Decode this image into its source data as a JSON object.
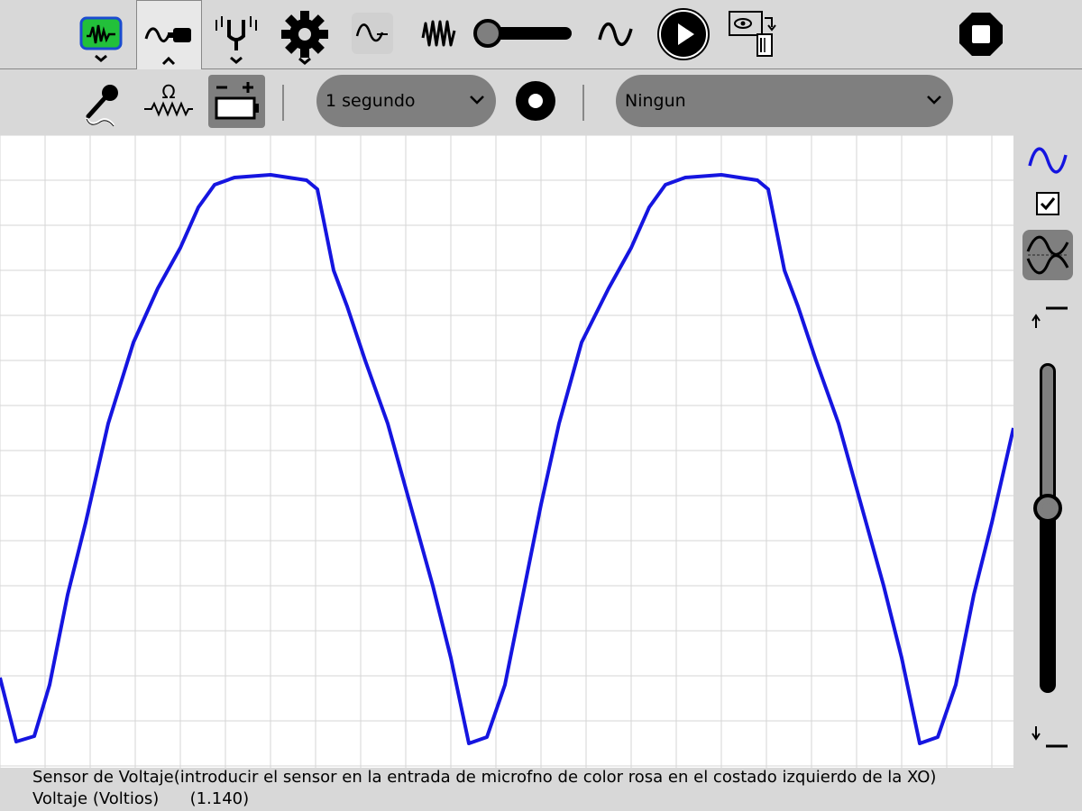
{
  "toolbar": {
    "items": [
      {
        "name": "activity-icon"
      },
      {
        "name": "sensor-tab-icon"
      },
      {
        "name": "tuning-fork-icon"
      },
      {
        "name": "settings-icon"
      },
      {
        "name": "sine-small-icon"
      },
      {
        "name": "waves-icon"
      },
      {
        "name": "frequency-slider"
      },
      {
        "name": "sine-icon"
      },
      {
        "name": "play-icon"
      },
      {
        "name": "save-capture-icon"
      },
      {
        "name": "stop-icon"
      }
    ]
  },
  "secondbar": {
    "interval_select": "1 segundo",
    "trigger_select": "Ningun"
  },
  "chart_data": {
    "type": "line",
    "title": "",
    "series": [
      {
        "color": "#1515e0",
        "points": [
          [
            0,
            752
          ],
          [
            18,
            823
          ],
          [
            38,
            817
          ],
          [
            55,
            760
          ],
          [
            75,
            660
          ],
          [
            95,
            580
          ],
          [
            120,
            470
          ],
          [
            148,
            380
          ],
          [
            175,
            320
          ],
          [
            200,
            275
          ],
          [
            220,
            230
          ],
          [
            238,
            205
          ],
          [
            260,
            197
          ],
          [
            300,
            194
          ],
          [
            340,
            200
          ],
          [
            352,
            210
          ],
          [
            360,
            250
          ],
          [
            370,
            300
          ],
          [
            385,
            340
          ],
          [
            405,
            400
          ],
          [
            430,
            470
          ],
          [
            455,
            560
          ],
          [
            480,
            650
          ],
          [
            500,
            730
          ],
          [
            520,
            825
          ],
          [
            540,
            818
          ],
          [
            560,
            760
          ],
          [
            580,
            660
          ],
          [
            600,
            560
          ],
          [
            620,
            470
          ],
          [
            645,
            380
          ],
          [
            675,
            320
          ],
          [
            700,
            275
          ],
          [
            720,
            230
          ],
          [
            738,
            205
          ],
          [
            760,
            197
          ],
          [
            800,
            194
          ],
          [
            840,
            200
          ],
          [
            852,
            210
          ],
          [
            860,
            250
          ],
          [
            870,
            300
          ],
          [
            885,
            340
          ],
          [
            905,
            400
          ],
          [
            930,
            470
          ],
          [
            955,
            560
          ],
          [
            980,
            650
          ],
          [
            1000,
            730
          ],
          [
            1020,
            825
          ],
          [
            1040,
            818
          ],
          [
            1060,
            760
          ],
          [
            1080,
            660
          ],
          [
            1100,
            580
          ],
          [
            1124,
            475
          ]
        ]
      }
    ],
    "grid": true
  },
  "status": {
    "line1": "Sensor de Voltaje(introducir el sensor en la entrada de microfno de color rosa en el costado izquierdo de la XO)",
    "line2": "Voltaje (Voltios)      (1.140)"
  }
}
